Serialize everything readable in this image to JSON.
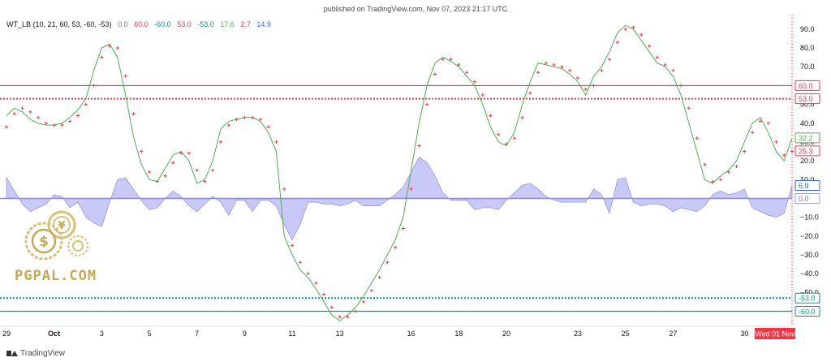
{
  "header": {
    "published": "published on TradingView.com, Nov 07, 2023 21:17 UTC"
  },
  "legend": {
    "name": "WT_LB (10, 21, 60, 53, -60, -53)",
    "values": [
      {
        "text": "0.0",
        "color": "#787b86"
      },
      {
        "text": "60.0",
        "color": "#f23645"
      },
      {
        "text": "-60.0",
        "color": "#089981"
      },
      {
        "text": "53.0",
        "color": "#f23645"
      },
      {
        "text": "-53.0",
        "color": "#089981"
      },
      {
        "text": "17.6",
        "color": "#4caf50"
      },
      {
        "text": "2.7",
        "color": "#f23645"
      },
      {
        "text": "14.9",
        "color": "#2962ff"
      }
    ]
  },
  "footer": {
    "brand": "TradingView"
  },
  "watermark": {
    "text": "PGPAL.COM"
  },
  "colors": {
    "wt1": "#4caf50",
    "wt2": "#f23645",
    "histogram_fill": "#bcbcf5",
    "histogram_line": "#8080e0",
    "overbought": "#f23645",
    "oversold": "#089981",
    "zero": "#8a8ad8",
    "date_badge": "#f23645"
  },
  "chart_data": {
    "type": "line",
    "ylim": [
      -68,
      96
    ],
    "y_ticks": [
      90,
      80,
      70,
      60,
      50,
      40,
      30,
      20,
      10,
      0,
      -10,
      -20,
      -30,
      -40,
      -50,
      -60
    ],
    "x_ticks": [
      {
        "label": "29",
        "i": 0
      },
      {
        "label": "Oct",
        "i": 6
      },
      {
        "label": "3",
        "i": 12
      },
      {
        "label": "5",
        "i": 18
      },
      {
        "label": "7",
        "i": 24
      },
      {
        "label": "9",
        "i": 30
      },
      {
        "label": "11",
        "i": 36
      },
      {
        "label": "13",
        "i": 42
      },
      {
        "label": "16",
        "i": 51
      },
      {
        "label": "18",
        "i": 57
      },
      {
        "label": "20",
        "i": 63
      },
      {
        "label": "23",
        "i": 72
      },
      {
        "label": "25",
        "i": 78
      },
      {
        "label": "27",
        "i": 84
      },
      {
        "label": "30",
        "i": 93
      }
    ],
    "current_date_label": "Wed 01 Nov",
    "levels": {
      "overbought": [
        60,
        53
      ],
      "oversold": [
        -60,
        -53
      ],
      "zero": 0
    },
    "level_labels": {
      "ob1": "60.0",
      "ob2": "53.0",
      "os1": "-60.0",
      "os2": "-53.0",
      "wt1_last": "32.2",
      "wt2_last": "25.3",
      "hist_last": "6.9",
      "zero": "0.0"
    },
    "series": [
      {
        "name": "",
        "role": "wt1",
        "values": [
          44,
          48,
          46,
          42,
          40,
          39,
          39,
          40,
          43,
          47,
          53,
          68,
          80,
          82,
          75,
          55,
          33,
          18,
          10,
          9,
          16,
          23,
          25,
          20,
          8,
          10,
          20,
          37,
          41,
          42,
          43,
          43,
          41,
          35,
          25,
          -20,
          -30,
          -38,
          -42,
          -48,
          -55,
          -62,
          -65,
          -62,
          -58,
          -52,
          -45,
          -38,
          -30,
          -22,
          -10,
          15,
          40,
          60,
          72,
          75,
          73,
          70,
          65,
          60,
          50,
          38,
          30,
          28,
          35,
          50,
          62,
          72,
          71,
          70,
          69,
          66,
          62,
          55,
          65,
          70,
          78,
          88,
          92,
          90,
          84,
          78,
          72,
          70,
          65,
          55,
          40,
          25,
          10,
          8,
          12,
          15,
          20,
          30,
          40,
          43,
          35,
          25,
          20,
          32
        ]
      },
      {
        "name": "",
        "role": "wt2",
        "values": [
          38,
          45,
          48,
          46,
          43,
          40,
          39,
          39,
          41,
          44,
          50,
          60,
          75,
          81,
          80,
          65,
          45,
          25,
          14,
          9,
          12,
          19,
          24,
          24,
          15,
          9,
          15,
          30,
          39,
          42,
          43,
          43,
          42,
          38,
          30,
          5,
          -25,
          -34,
          -40,
          -45,
          -51,
          -58,
          -63,
          -63,
          -60,
          -55,
          -49,
          -42,
          -34,
          -26,
          -16,
          5,
          28,
          50,
          66,
          74,
          74,
          71,
          67,
          62,
          55,
          44,
          34,
          29,
          32,
          43,
          56,
          67,
          72,
          71,
          70,
          68,
          64,
          58,
          60,
          68,
          74,
          83,
          90,
          91,
          87,
          81,
          75,
          71,
          68,
          60,
          48,
          32,
          18,
          9,
          10,
          14,
          17,
          25,
          35,
          41,
          40,
          30,
          23,
          25
        ]
      },
      {
        "name": "",
        "role": "histogram",
        "values": [
          11,
          4,
          -3,
          -7,
          -5,
          -3,
          2,
          1,
          -5,
          -2,
          -10,
          -13,
          -15,
          -2,
          10,
          11,
          5,
          -1,
          -6,
          -5,
          0,
          4,
          1,
          -4,
          -7,
          -3,
          1,
          -2,
          -9,
          -1,
          -1,
          -7,
          -1,
          -1,
          -4,
          -14,
          -22,
          -14,
          -2,
          -2,
          -3,
          -3,
          -4,
          -3,
          -1,
          -4,
          -4,
          -4,
          -1,
          2,
          6,
          14,
          22,
          19,
          12,
          3,
          -1,
          -1,
          -1,
          -6,
          -5,
          -5,
          -6,
          -1,
          3,
          7,
          8,
          5,
          1,
          -1,
          -2,
          -2,
          -2,
          -2,
          5,
          2,
          -8,
          10,
          11,
          -2,
          -4,
          -3,
          -3,
          -4,
          -7,
          -5,
          -6,
          -7,
          -4,
          2,
          4,
          2,
          3,
          5,
          -5,
          -7,
          -9,
          -10,
          -8,
          7
        ]
      }
    ]
  }
}
